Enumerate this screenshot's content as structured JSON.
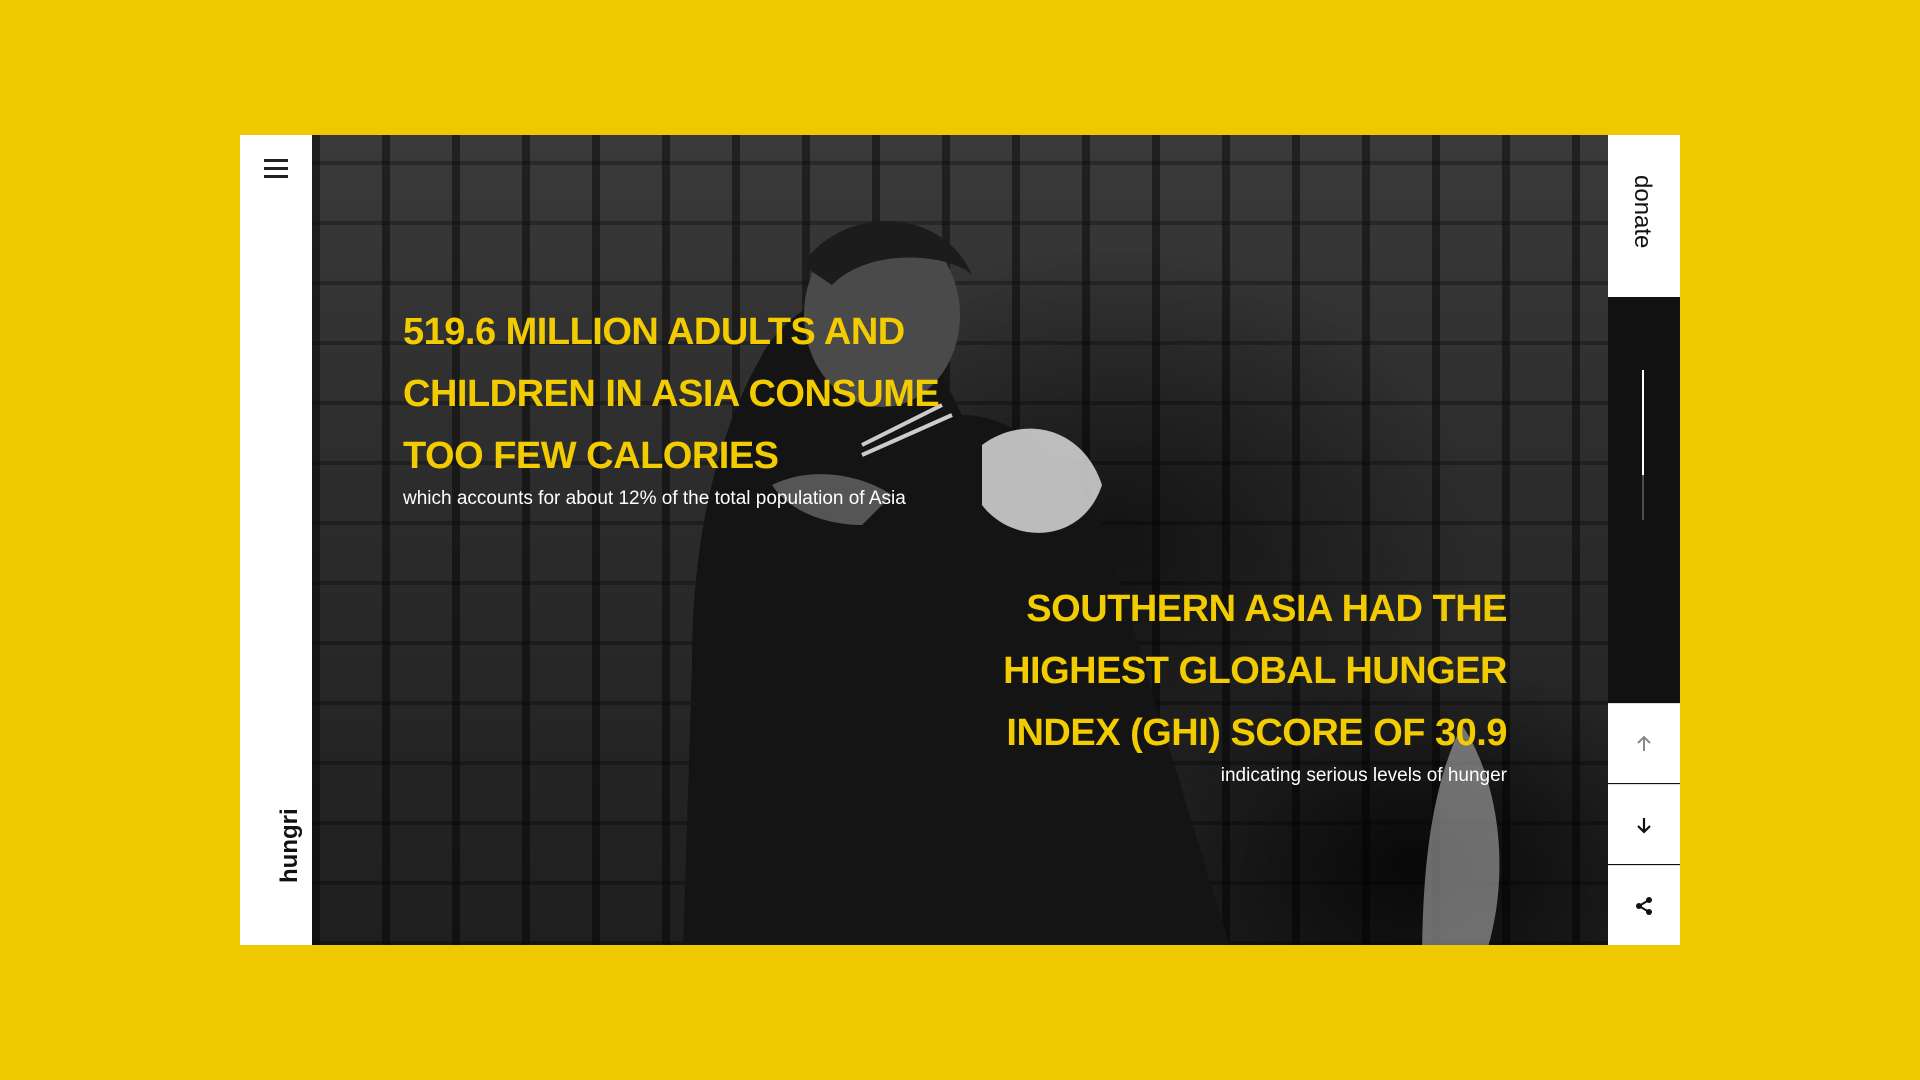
{
  "brand": {
    "name": "hungri"
  },
  "actions": {
    "donate_label": "donate"
  },
  "stats": [
    {
      "headline": "519.6 MILLION ADULTS AND CHILDREN IN ASIA CONSUME TOO FEW CALORIES",
      "subtext": "which accounts for about 12% of the total population of Asia"
    },
    {
      "headline": "SOUTHERN ASIA HAD THE HIGHEST GLOBAL HUNGER INDEX (GHI) SCORE OF 30.9",
      "subtext": "indicating serious levels of hunger"
    }
  ],
  "scroll": {
    "progress": 0.7
  },
  "icons": {
    "menu": "hamburger-menu-icon",
    "up": "arrow-up-icon",
    "down": "arrow-down-icon",
    "share": "share-icon"
  },
  "colors": {
    "background": "#efc900",
    "accent": "#f2cc00",
    "rail": "#ffffff"
  }
}
